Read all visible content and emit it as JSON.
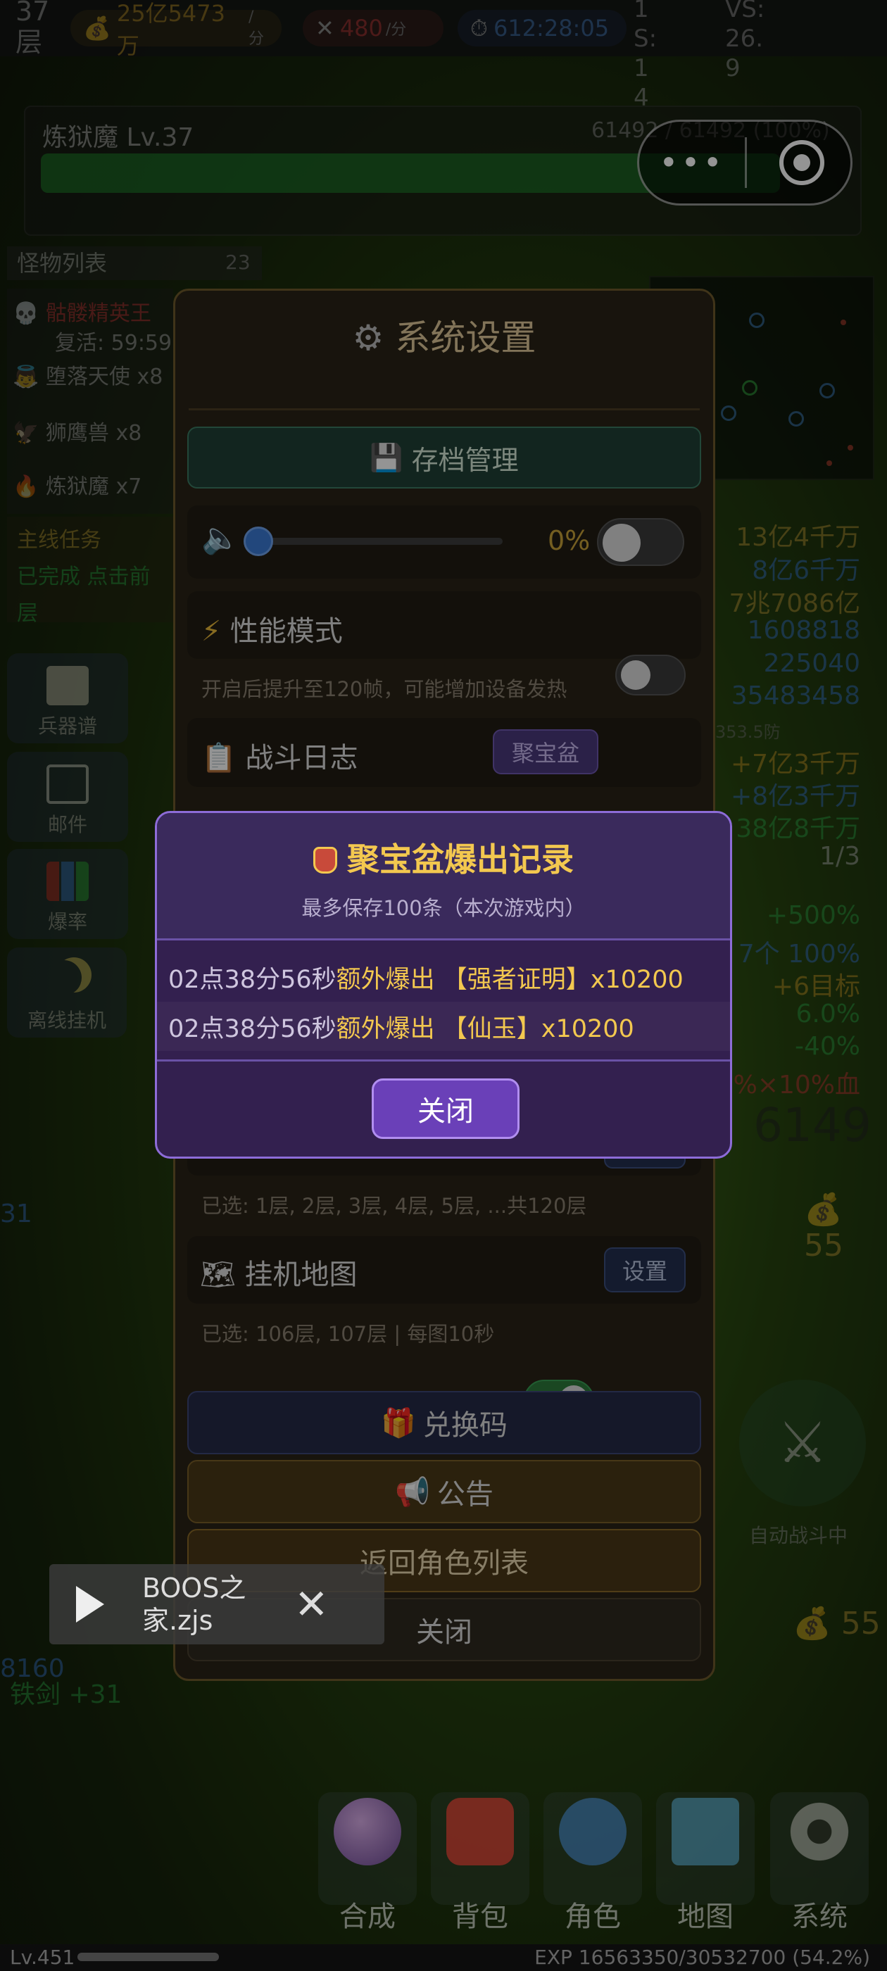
{
  "topbar": {
    "floor": "37 层",
    "gold_rate": "25亿5473万",
    "gold_unit": "/分",
    "kill_rate": "480",
    "kill_unit": "/分",
    "timer": "612:28:05",
    "side_a": "1 S: 1 4",
    "side_b": "VS: 26. 9"
  },
  "boss": {
    "name": "炼狱魔 Lv.37",
    "hp_text": "61492 / 61492 (100%)",
    "hp_fraction": 1.0
  },
  "capsule": {
    "more_label": "•••",
    "close_label": ""
  },
  "monster_list": {
    "title": "怪物列表",
    "count": "23",
    "items": [
      {
        "icon": "skull-icon",
        "text": "骷髅精英王",
        "sub": "复活: 59:59"
      },
      {
        "icon": "angel-icon",
        "text": "堕落天使 x8"
      },
      {
        "icon": "griffin-icon",
        "text": "狮鹰兽 x8"
      },
      {
        "icon": "fire-icon",
        "text": "炼狱魔 x7"
      }
    ]
  },
  "quest": {
    "title": "主线任务",
    "line1": "已完成 点击前",
    "line2": "层"
  },
  "left_tiles": [
    {
      "label": "兵器谱",
      "icon": "book-icon"
    },
    {
      "label": "邮件",
      "icon": "mail-icon"
    },
    {
      "label": "爆率",
      "icon": "bar-chart-icon"
    },
    {
      "label": "离线挂机",
      "icon": "moon-icon"
    }
  ],
  "right_stats": [
    {
      "text": "13亿4千万",
      "color": "#c9a23a"
    },
    {
      "text": "8亿6千万",
      "color": "#3b7bd6"
    },
    {
      "text": "7兆7086亿",
      "color": "#c9a23a"
    },
    {
      "text": "1608818",
      "color": "#3b7bd6"
    },
    {
      "text": "225040",
      "color": "#3b7bd6"
    },
    {
      "text": "35483458",
      "color": "#3b7bd6"
    },
    {
      "text": "+7亿3千万",
      "color": "#d4a02a"
    },
    {
      "text": "+8亿3千万",
      "color": "#3b7bd6"
    },
    {
      "text": "38亿8千万",
      "color": "#2fae4a"
    },
    {
      "text": "1/3",
      "color": "#bbb"
    },
    {
      "text": "+500%",
      "color": "#2fae4a"
    },
    {
      "text": "7个 100%",
      "color": "#3b7bd6"
    },
    {
      "text": "+6目标",
      "color": "#d4a02a"
    },
    {
      "text": "6.0%",
      "color": "#2fae4a"
    },
    {
      "text": "-40%",
      "color": "#2fae4a"
    },
    {
      "text": "3%×10%血",
      "color": "#d43a3a"
    }
  ],
  "right_misc": {
    "big_number": "6149",
    "gold_a": "55",
    "gold_b": "55",
    "auto_battle": "自动战斗中",
    "small_note": "353.5防"
  },
  "left_misc": {
    "num_a": "31",
    "num_b": "8160",
    "num_c": "铁剑 +31"
  },
  "settings": {
    "title": "系统设置",
    "save_btn": "存档管理",
    "volume_pct": "0%",
    "volume_fraction": 0.0,
    "perf_label": "性能模式",
    "perf_hint": "开启后提升至120帧，可能增加设备发热",
    "log_label": "战斗日志",
    "log_btn": "聚宝盆",
    "floors_hint": "已选: 1层, 2层, 3层, 4层, 5层, ...共120层",
    "map_label": "挂机地图",
    "map_btn": "设置",
    "map_hint": "已选: 106层, 107层 | 每图10秒",
    "redeem_btn": "兑换码",
    "notice_btn": "公告",
    "back_btn": "返回角色列表",
    "close_btn": "关闭"
  },
  "modal": {
    "title": "聚宝盆爆出记录",
    "subtitle": "最多保存100条（本次游戏内）",
    "records": [
      {
        "time": "02点38分56秒",
        "text": "额外爆出 【强者证明】x10200"
      },
      {
        "time": "02点38分56秒",
        "text": "额外爆出 【仙玉】x10200"
      }
    ],
    "close_btn": "关闭"
  },
  "toast": {
    "text": "BOOS之家.zjs"
  },
  "nav": [
    {
      "label": "合成",
      "icon": "crystal-ball-icon"
    },
    {
      "label": "背包",
      "icon": "backpack-icon"
    },
    {
      "label": "角色",
      "icon": "person-icon"
    },
    {
      "label": "地图",
      "icon": "map-icon"
    },
    {
      "label": "系统",
      "icon": "gear-icon"
    }
  ],
  "footer": {
    "level": "Lv.451",
    "exp": "EXP 16563350/30532700 (54.2%)",
    "exp_fraction": 0.542
  },
  "colors": {
    "modal_bg": "#33204f",
    "modal_border": "#8d6cd8",
    "gold_text": "#f3c84f",
    "panel_bg": "#2a2418"
  }
}
